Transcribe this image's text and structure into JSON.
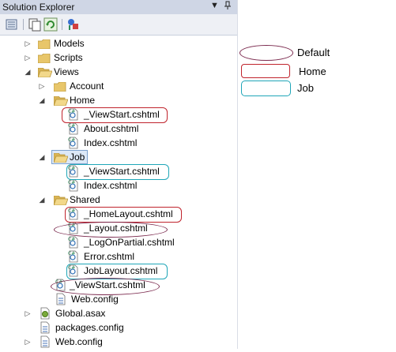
{
  "panel": {
    "title": "Solution Explorer",
    "pin_symbol": "▼",
    "pushpin_symbol": "ᵠ"
  },
  "tree": [
    {
      "label": "Models",
      "kind": "folder",
      "level": 1,
      "expander": "▷"
    },
    {
      "label": "Scripts",
      "kind": "folder",
      "level": 1,
      "expander": "▷"
    },
    {
      "label": "Views",
      "kind": "folder-open",
      "level": 1,
      "expander": "◢"
    },
    {
      "label": "Account",
      "kind": "folder",
      "level": 2,
      "expander": "▷"
    },
    {
      "label": "Home",
      "kind": "folder-open",
      "level": 2,
      "expander": "◢"
    },
    {
      "label": "_ViewStart.cshtml",
      "kind": "cshtml",
      "level": 3
    },
    {
      "label": "About.cshtml",
      "kind": "cshtml",
      "level": 3
    },
    {
      "label": "Index.cshtml",
      "kind": "cshtml",
      "level": 3
    },
    {
      "label": "Job",
      "kind": "folder-open",
      "level": 2,
      "expander": "◢",
      "selected": true
    },
    {
      "label": "_ViewStart.cshtml",
      "kind": "cshtml",
      "level": 3
    },
    {
      "label": "Index.cshtml",
      "kind": "cshtml",
      "level": 3
    },
    {
      "label": "Shared",
      "kind": "folder-open",
      "level": 2,
      "expander": "◢"
    },
    {
      "label": "_HomeLayout.cshtml",
      "kind": "cshtml",
      "level": 3
    },
    {
      "label": "_Layout.cshtml",
      "kind": "cshtml",
      "level": 3
    },
    {
      "label": "_LogOnPartial.cshtml",
      "kind": "cshtml",
      "level": 3
    },
    {
      "label": "Error.cshtml",
      "kind": "cshtml",
      "level": 3
    },
    {
      "label": "JobLayout.cshtml",
      "kind": "cshtml",
      "level": 3
    },
    {
      "label": "_ViewStart.cshtml",
      "kind": "cshtml",
      "level": 2
    },
    {
      "label": "Web.config",
      "kind": "config",
      "level": 2
    },
    {
      "label": "Global.asax",
      "kind": "asax",
      "level": 1,
      "expander": "▷"
    },
    {
      "label": "packages.config",
      "kind": "config",
      "level": 1
    },
    {
      "label": "Web.config",
      "kind": "config",
      "level": 1,
      "expander": "▷"
    }
  ],
  "legend": {
    "default_label": "Default",
    "home_label": "Home",
    "job_label": "Job"
  },
  "colors": {
    "default_oval": "#7b2a4e",
    "home_rect": "#c0242d",
    "job_rect": "#1fa6b8",
    "folder": "#e8c66a",
    "selection": "#dce8f7"
  }
}
